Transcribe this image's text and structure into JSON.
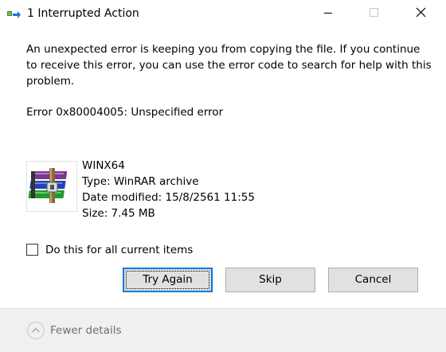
{
  "window": {
    "title": "1 Interrupted Action",
    "icon": "file-copy-arrow-icon",
    "controls": [
      "minimize-icon",
      "maximize-icon",
      "close-icon"
    ]
  },
  "message": {
    "text": "An unexpected error is keeping you from copying the file. If you continue to receive this error, you can use the error code to search for help with this problem.",
    "error_code": "Error 0x80004005: Unspecified error"
  },
  "file": {
    "icon": "winrar-archive-icon",
    "name": "WINX64",
    "type": "Type: WinRAR archive",
    "date_modified": "Date modified: 15/8/2561 11:55",
    "size": "Size: 7.45 MB"
  },
  "checkbox": {
    "label": "Do this for all current items",
    "checked": false
  },
  "buttons": {
    "try_again": "Try Again",
    "skip": "Skip",
    "cancel": "Cancel"
  },
  "footer": {
    "toggle_label": "Fewer details",
    "toggle_icon": "chevron-up-circle-icon"
  },
  "colors": {
    "accent": "#0078d7",
    "footer_bg": "#f0f0f0",
    "button_bg": "#e1e1e1"
  }
}
